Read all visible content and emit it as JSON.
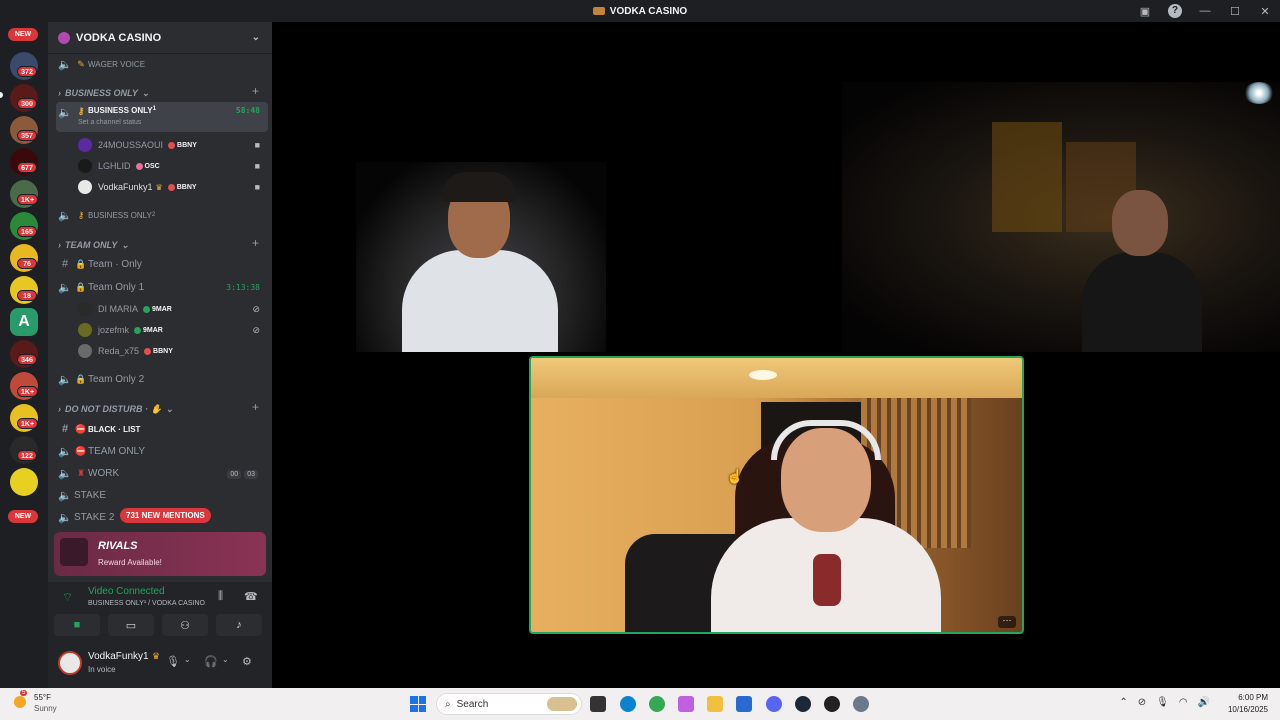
{
  "window": {
    "title": "VODKA CASINO"
  },
  "server_rail": {
    "badges": [
      "NEW",
      "372",
      "300",
      "357",
      "677",
      "1K+",
      "165",
      "76",
      "18",
      "346",
      "1K+",
      "1K+",
      "122",
      "NEW"
    ],
    "server_letter": "A"
  },
  "guild": {
    "name": "VODKA CASINO"
  },
  "channels": {
    "wager_voice": "WAGER VOICE",
    "cat_business": "BUSINESS ONLY",
    "business_active": {
      "name": "BUSINESS ONLY",
      "sup": "1",
      "status": "Set a channel status",
      "timer": "58:48"
    },
    "business_users": [
      {
        "name": "24MOUSSAOUI",
        "tag": "BBNY"
      },
      {
        "name": "LGHLID",
        "tag": "OSC"
      },
      {
        "name": "VodkaFunky1",
        "tag": "BBNY"
      }
    ],
    "business_2": {
      "name": "BUSINESS ONLY",
      "sup": "2"
    },
    "cat_team": "TEAM ONLY",
    "team_text": "Team · Only",
    "team_voice": {
      "name": "Team Only 1",
      "timer": "3:13:38"
    },
    "team_users": [
      {
        "name": "DI MARIA",
        "tag": "9MAR"
      },
      {
        "name": "jozefmk",
        "tag": "9MAR"
      },
      {
        "name": "Reda_x75",
        "tag": "BBNY"
      }
    ],
    "team_voice_2": "Team Only 2",
    "cat_dnd": "DO NOT DISTURB · ✋",
    "black_list": "BLACK · LIST",
    "team_only_caps": "TEAM ONLY",
    "work": {
      "name": "WORK",
      "a": "00",
      "b": "03"
    },
    "stake": "STAKE",
    "stake2": "STAKE 2",
    "mentions": "731 NEW MENTIONS"
  },
  "promo": {
    "title": "RIVALS",
    "subtitle": "Reward Available!"
  },
  "voice_panel": {
    "status": "Video Connected",
    "channel": "BUSINESS ONLY¹ / VODKA CASINO"
  },
  "user_panel": {
    "name": "VodkaFunky1",
    "status": "In voice"
  },
  "taskbar": {
    "temp": "55°F",
    "condition": "Sunny",
    "weather_badge": "5",
    "search_label": "Search",
    "time": "6:00 PM",
    "date": "10/16/2025"
  }
}
